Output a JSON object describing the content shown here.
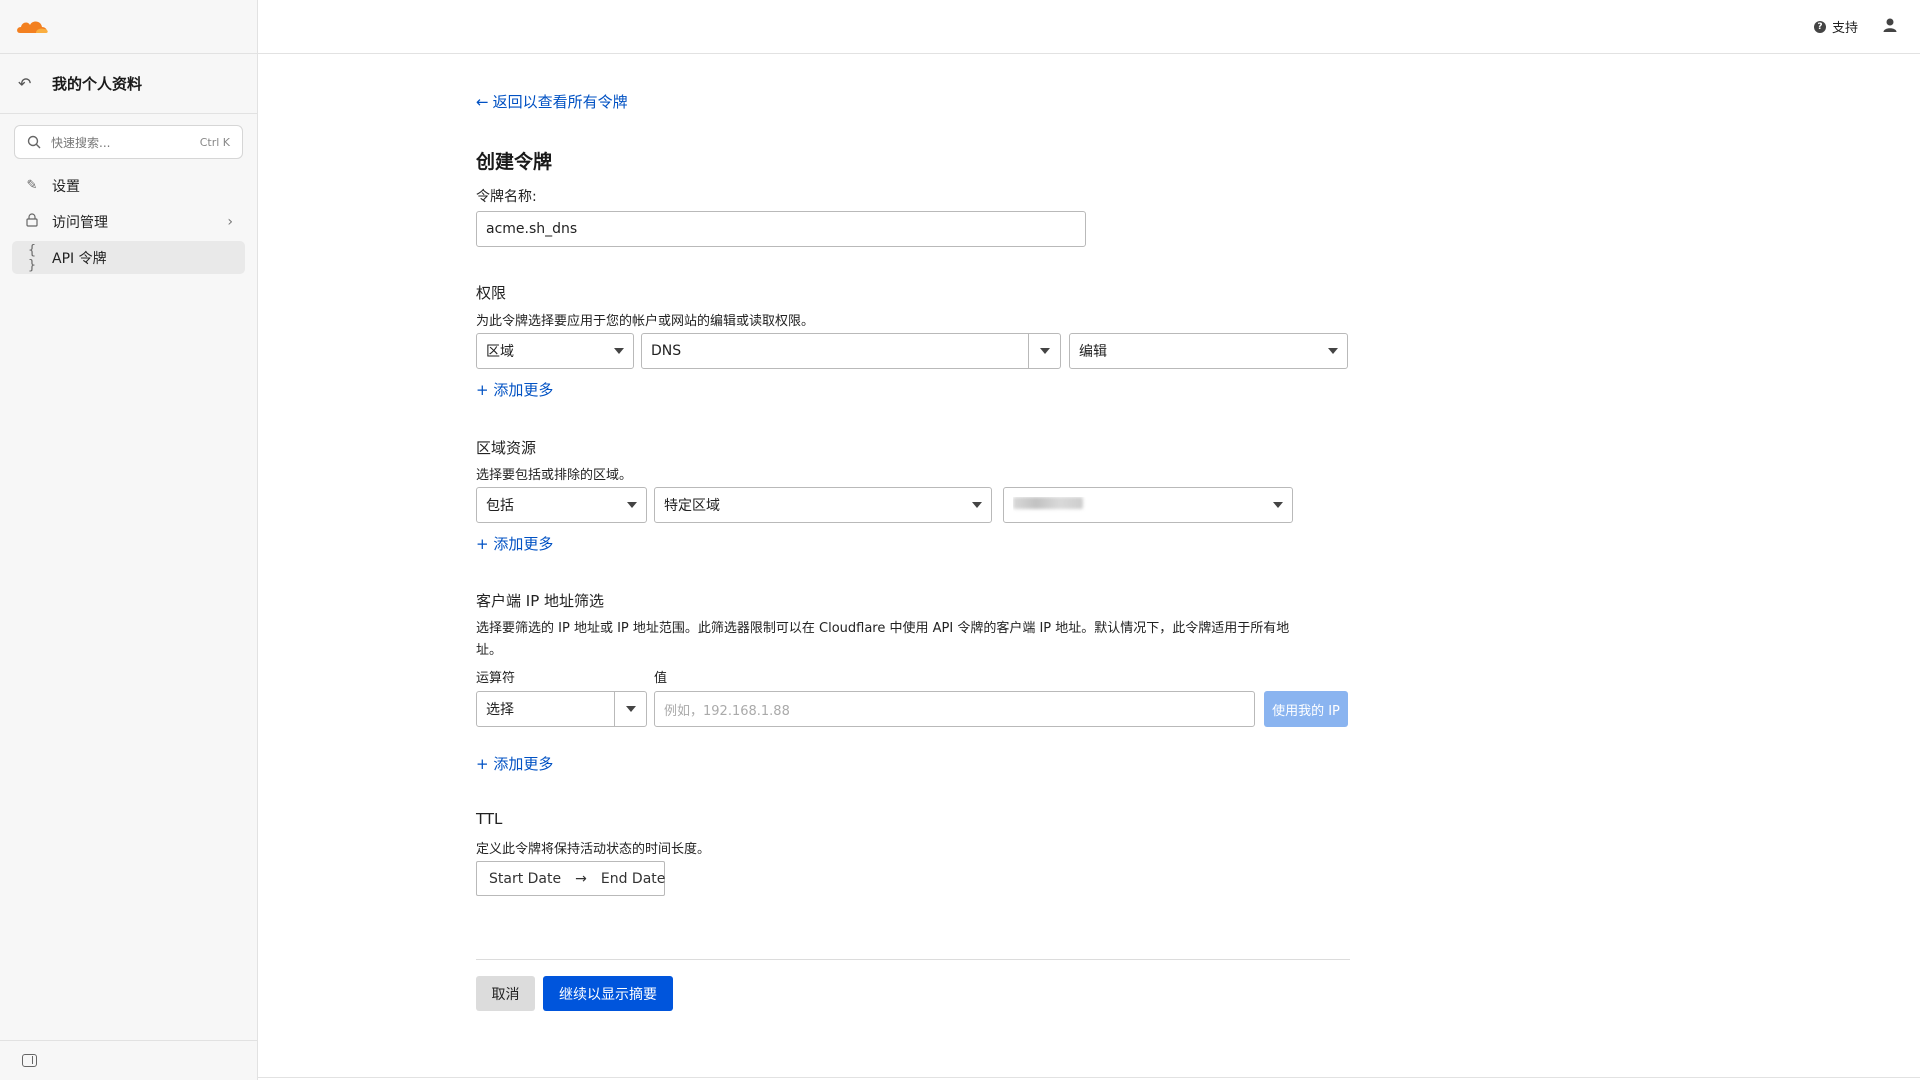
{
  "sidebar": {
    "profile_title": "我的个人资料",
    "search": {
      "placeholder": "快速搜索...",
      "shortcut": "Ctrl K"
    },
    "items": [
      {
        "label": "设置",
        "icon": "edit-icon"
      },
      {
        "label": "访问管理",
        "icon": "lock-icon",
        "has_children": true
      },
      {
        "label": "API 令牌",
        "icon": "braces-icon",
        "active": true
      }
    ]
  },
  "topbar": {
    "support_label": "支持"
  },
  "main": {
    "back_link": "返回以查看所有令牌",
    "title": "创建令牌",
    "token_name_label": "令牌名称:",
    "token_name_value": "acme.sh_dns",
    "permissions": {
      "title": "权限",
      "description": "为此令牌选择要应用于您的帐户或网站的编辑或读取权限。",
      "scope": "区域",
      "resource": "DNS",
      "access": "编辑",
      "add_more": "+ 添加更多"
    },
    "zone_resources": {
      "title": "区域资源",
      "description": "选择要包括或排除的区域。",
      "include": "包括",
      "type": "特定区域",
      "add_more": "+ 添加更多"
    },
    "ip_filter": {
      "title": "客户端 IP 地址筛选",
      "description_line1": "选择要筛选的 IP 地址或 IP 地址范围。此筛选器限制可以在 Cloudflare 中使用 API 令牌的客户端 IP 地址。默认情况下，此令牌适用于所有地",
      "description_line2": "址。",
      "operator_label": "运算符",
      "value_label": "值",
      "operator_value": "选择",
      "value_placeholder": "例如，192.168.1.88",
      "use_my_ip": "使用我的 IP",
      "add_more": "+ 添加更多"
    },
    "ttl": {
      "title": "TTL",
      "description": "定义此令牌将保持活动状态的时间长度。",
      "start": "Start Date",
      "end": "End Date"
    },
    "actions": {
      "cancel": "取消",
      "continue": "继续以显示摘要"
    }
  },
  "colors": {
    "accent": "#0051c3",
    "primary_button": "#0055dc",
    "brand_orange": "#f38020"
  }
}
